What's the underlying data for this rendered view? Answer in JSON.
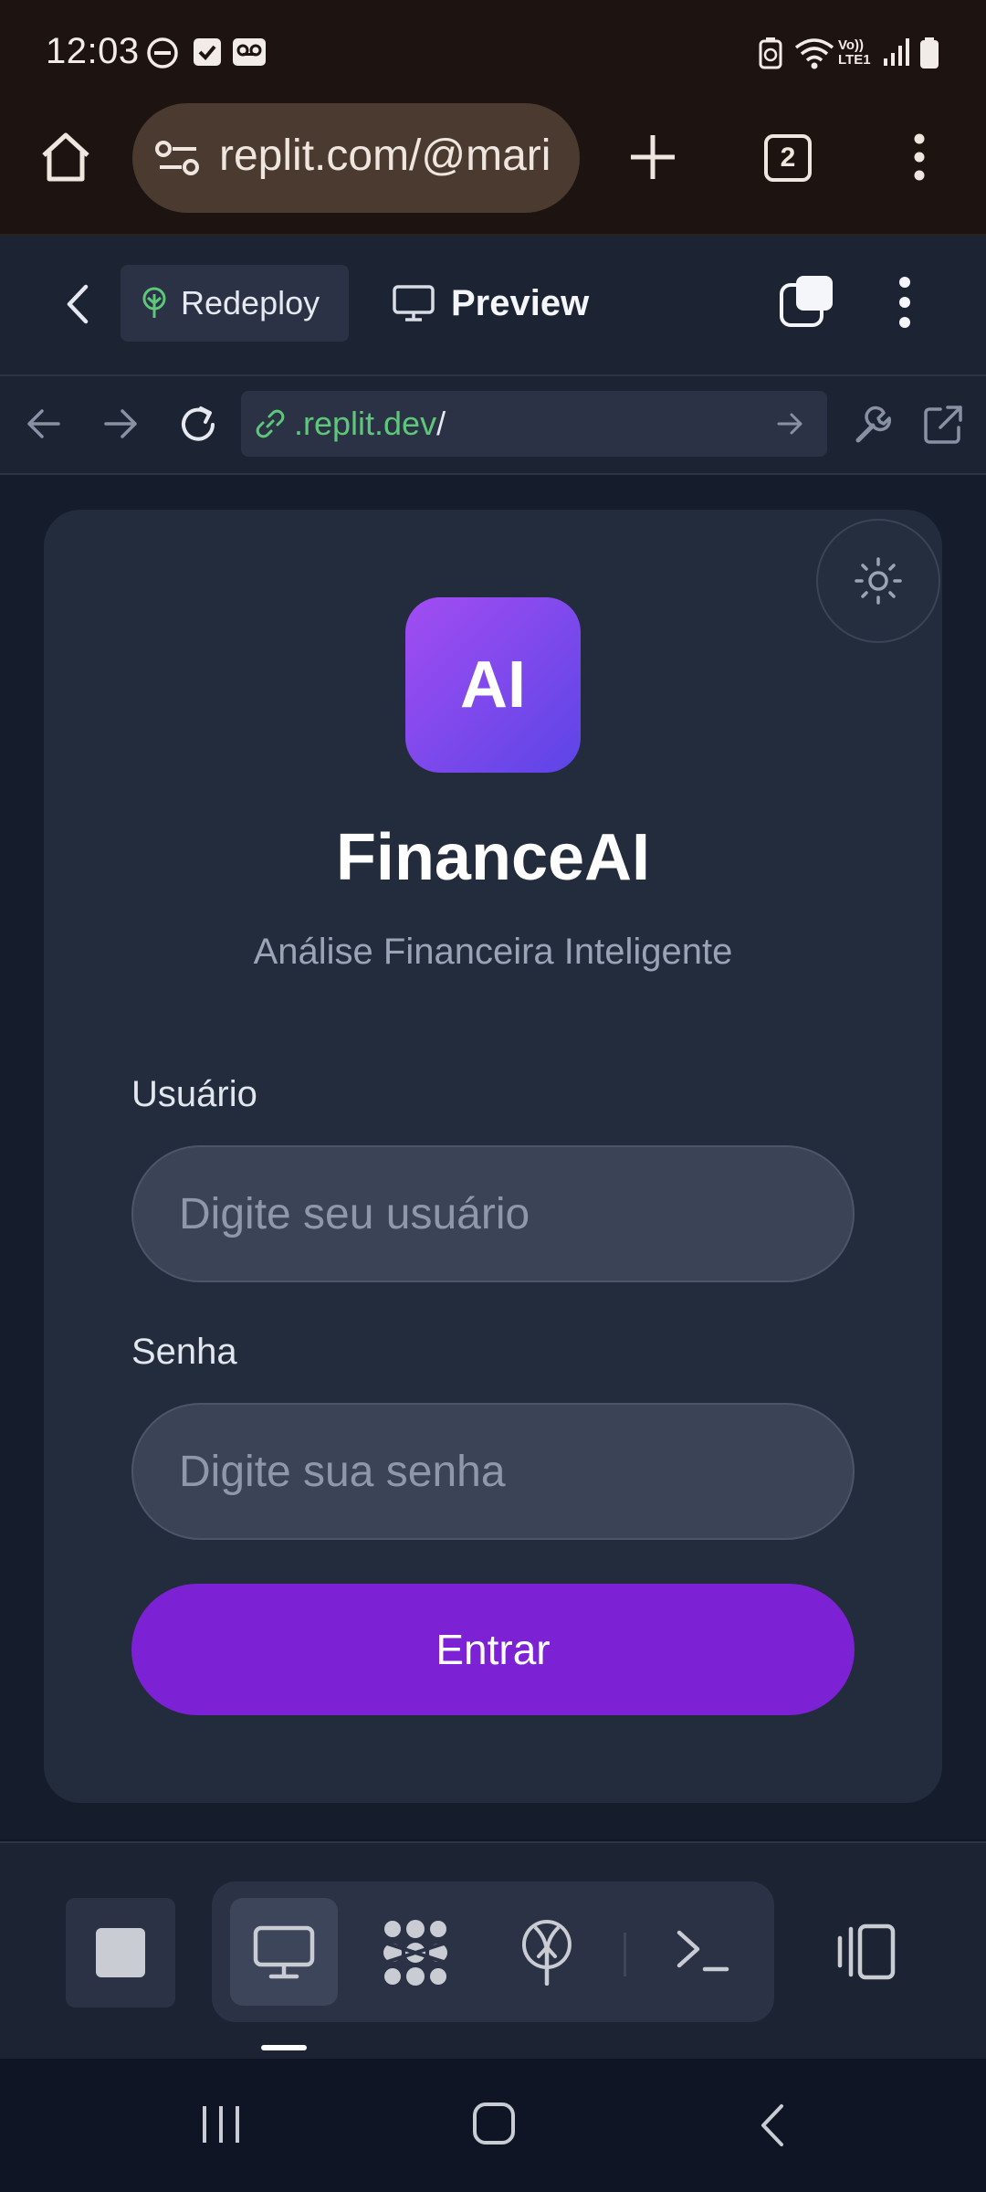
{
  "status_bar": {
    "time": "12:03",
    "icons": [
      "do-not-disturb-icon",
      "checkbox-icon",
      "voicemail-icon",
      "battery-saver-icon",
      "wifi-icon",
      "volte-icon",
      "signal-icon",
      "battery-icon"
    ],
    "volte_text": "Vo)) LTE1"
  },
  "browser": {
    "url": "replit.com/@mari",
    "tab_count": "2"
  },
  "replit_toolbar": {
    "redeploy_label": "Redeploy",
    "preview_label": "Preview"
  },
  "preview_nav": {
    "url_domain": ".replit.dev",
    "url_path": "/"
  },
  "login": {
    "logo_text": "AI",
    "title": "FinanceAI",
    "subtitle": "Análise Financeira Inteligente",
    "username_label": "Usuário",
    "username_placeholder": "Digite seu usuário",
    "username_value": "",
    "password_label": "Senha",
    "password_placeholder": "Digite sua senha",
    "password_value": "",
    "submit_label": "Entrar"
  },
  "dock": {
    "items": [
      "stop-icon",
      "monitor-icon",
      "agent-icon",
      "deploy-icon",
      "shell-icon",
      "layout-icon"
    ],
    "active": "monitor-icon"
  },
  "colors": {
    "accent": "#7c21d4",
    "logo_gradient_start": "#a24df2",
    "logo_gradient_end": "#5c45e6",
    "link_green": "#5ec77a",
    "card_bg": "#232c3c"
  }
}
